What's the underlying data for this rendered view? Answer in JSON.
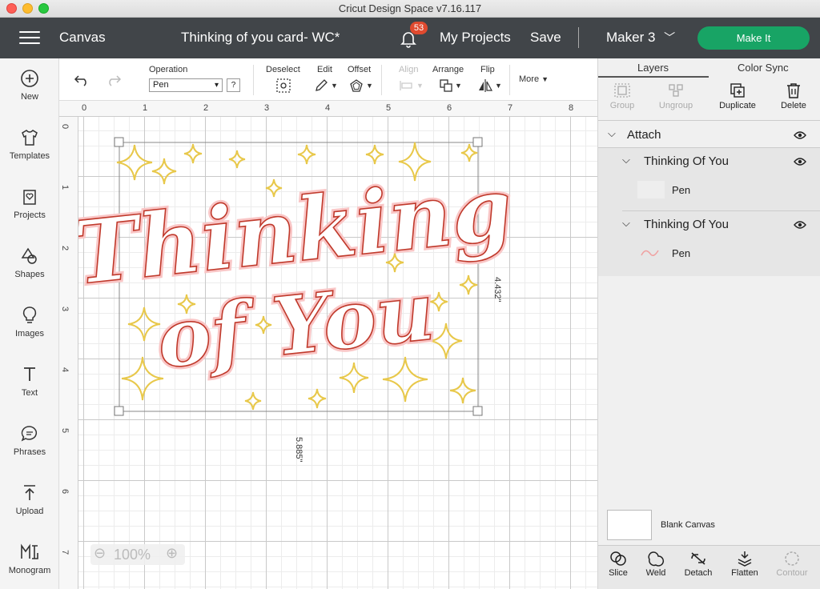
{
  "window": {
    "title": "Cricut Design Space  v7.16.117"
  },
  "header": {
    "canvas_label": "Canvas",
    "project_title": "Thinking of you card- WC*",
    "notification_count": "53",
    "my_projects": "My Projects",
    "save": "Save",
    "machine": "Maker 3",
    "make_it": "Make It"
  },
  "sidebar": {
    "items": [
      {
        "label": "New",
        "icon": "plus-circle-icon"
      },
      {
        "label": "Templates",
        "icon": "shirt-icon"
      },
      {
        "label": "Projects",
        "icon": "projects-icon"
      },
      {
        "label": "Shapes",
        "icon": "shapes-icon"
      },
      {
        "label": "Images",
        "icon": "lightbulb-icon"
      },
      {
        "label": "Text",
        "icon": "text-icon"
      },
      {
        "label": "Phrases",
        "icon": "speech-bubble-icon"
      },
      {
        "label": "Upload",
        "icon": "upload-icon"
      },
      {
        "label": "Monogram",
        "icon": "monogram-icon"
      }
    ]
  },
  "toolbar": {
    "operation_label": "Operation",
    "operation_value": "Pen",
    "help": "?",
    "deselect": "Deselect",
    "edit": "Edit",
    "offset": "Offset",
    "align": "Align",
    "arrange": "Arrange",
    "flip": "Flip",
    "more": "More"
  },
  "ruler": {
    "top": [
      "0",
      "1",
      "2",
      "3",
      "4",
      "5",
      "6",
      "7",
      "8"
    ],
    "left": [
      "0",
      "1",
      "2",
      "3",
      "4",
      "5",
      "6",
      "7"
    ]
  },
  "design": {
    "text_line1": "Thinking",
    "text_line2": "of You",
    "height_label": "4.432\"",
    "width_label": "5.885\"",
    "colors": {
      "pen": "#c0392b",
      "fill": "#f9c6c6",
      "stars": "#e8c84a"
    }
  },
  "zoom": {
    "value": "100%"
  },
  "panel": {
    "tabs": [
      "Layers",
      "Color Sync"
    ],
    "tools": [
      {
        "label": "Group",
        "enabled": false
      },
      {
        "label": "Ungroup",
        "enabled": false
      },
      {
        "label": "Duplicate",
        "enabled": true
      },
      {
        "label": "Delete",
        "enabled": true
      }
    ],
    "layers": {
      "group": "Attach",
      "items": [
        {
          "name": "Thinking Of You",
          "operation": "Pen"
        },
        {
          "name": "Thinking Of You",
          "operation": "Pen"
        }
      ]
    },
    "blank_canvas": "Blank Canvas",
    "bottom_tools": [
      {
        "label": "Slice",
        "enabled": true
      },
      {
        "label": "Weld",
        "enabled": true
      },
      {
        "label": "Detach",
        "enabled": true
      },
      {
        "label": "Flatten",
        "enabled": true
      },
      {
        "label": "Contour",
        "enabled": false
      }
    ]
  }
}
